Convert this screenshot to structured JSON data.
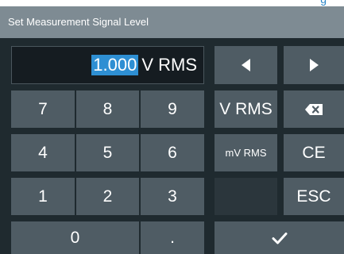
{
  "title": "Set Measurement Signal Level",
  "top_glimpse": "g",
  "entry": {
    "value": "1.000",
    "unit": "V RMS"
  },
  "keys": {
    "seven": "7",
    "eight": "8",
    "nine": "9",
    "four": "4",
    "five": "5",
    "six": "6",
    "one": "1",
    "two": "2",
    "three": "3",
    "zero": "0",
    "decimal": ".",
    "unit_v_rms": "V RMS",
    "unit_mv_rms": "mV RMS",
    "clear_entry": "CE",
    "escape": "ESC"
  },
  "icons": {
    "cursor_left": "arrow-left-icon",
    "cursor_right": "arrow-right-icon",
    "backspace": "backspace-icon",
    "confirm": "checkmark-icon"
  },
  "colors": {
    "title_bar": "#7e8b93",
    "panel": "#1f2a2f",
    "key": "#4f5c64",
    "selection": "#2e8fd3"
  }
}
